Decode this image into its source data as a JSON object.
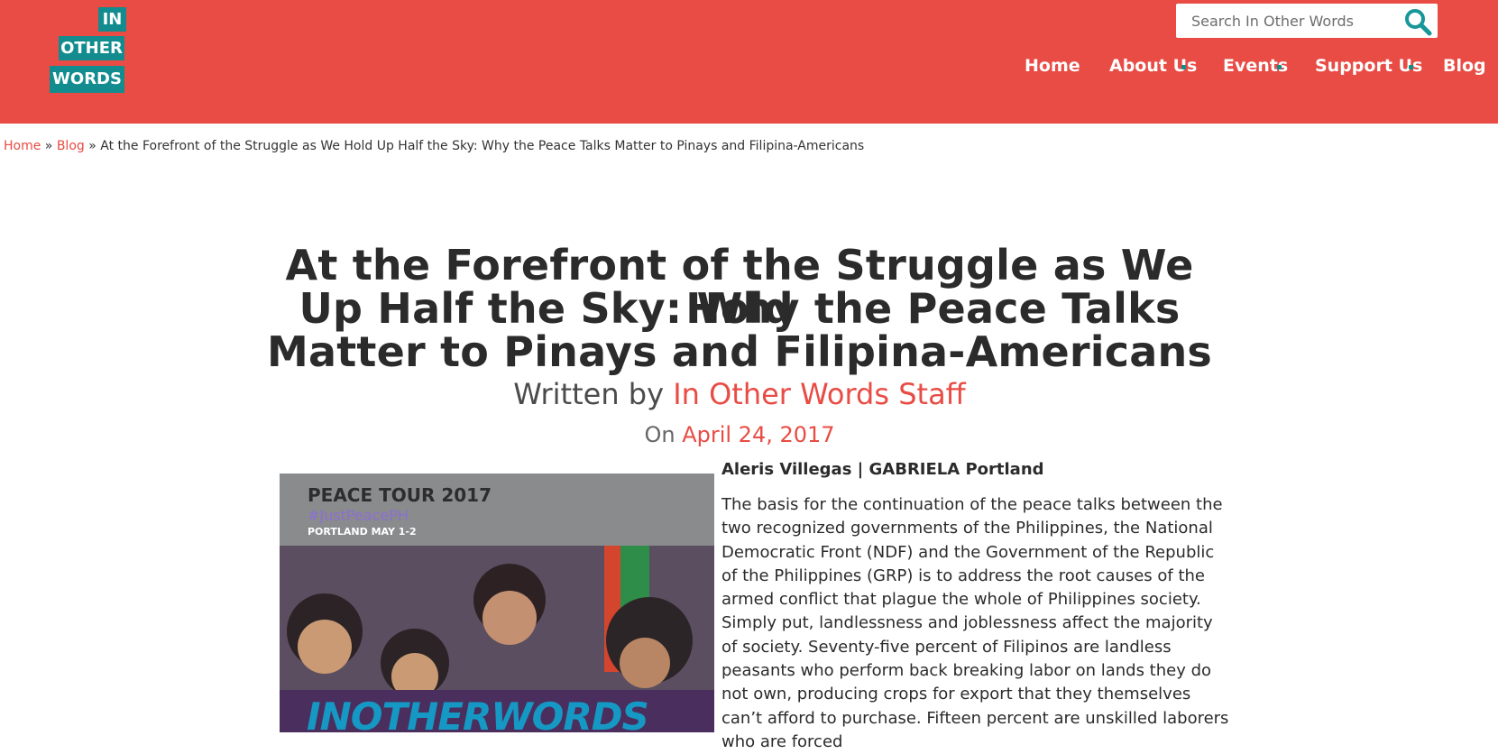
{
  "logo": {
    "line1": "IN",
    "line2": "OTHER",
    "line3": "WORDS"
  },
  "search": {
    "placeholder": "Search In Other Words",
    "icon": "search-icon"
  },
  "nav": [
    {
      "label": "Home"
    },
    {
      "label": "About Us"
    },
    {
      "label": "Events"
    },
    {
      "label": "Support Us"
    },
    {
      "label": "Blog"
    }
  ],
  "breadcrumb": {
    "home": "Home",
    "blog": "Blog",
    "sep": "»",
    "current": "At the Forefront of the Struggle as We Hold Up Half the Sky: Why the Peace Talks Matter to Pinays and Filipina-Americans"
  },
  "article": {
    "title_line1": "At the Forefront of the Struggle as We Hold",
    "title_line2": "Up Half the Sky: Why the Peace Talks",
    "title_line3": "Matter to Pinays and Filipina-Americans",
    "written_by": "Written by",
    "author": "In Other Words Staff",
    "on": "On",
    "date": "April 24, 2017",
    "attribution": "Aleris Villegas | GABRIELA Portland",
    "paragraph": "The basis for the continuation of the peace talks between the two recognized governments of the Philippines, the National Democratic Front (NDF) and the Government of the Republic of the Philippines (GRP) is to address the root causes of the armed conflict that plague the whole of Philippines society. Simply put, landlessness and joblessness affect the majority of society. Seventy-five percent of Filipinos are landless peasants who perform back breaking labor on lands they do not own, producing crops for export that they themselves can’t afford to purchase. Fifteen percent are unskilled laborers who are forced"
  },
  "image": {
    "tour": "PEACE TOUR 2017",
    "hashtag": "#JustPeacePH",
    "location": "PORTLAND MAY 1-2",
    "overlay": "INOTHERWORDS"
  },
  "colors": {
    "header": "#e84c44",
    "accent": "#e84c44",
    "teal": "#128c8e"
  }
}
